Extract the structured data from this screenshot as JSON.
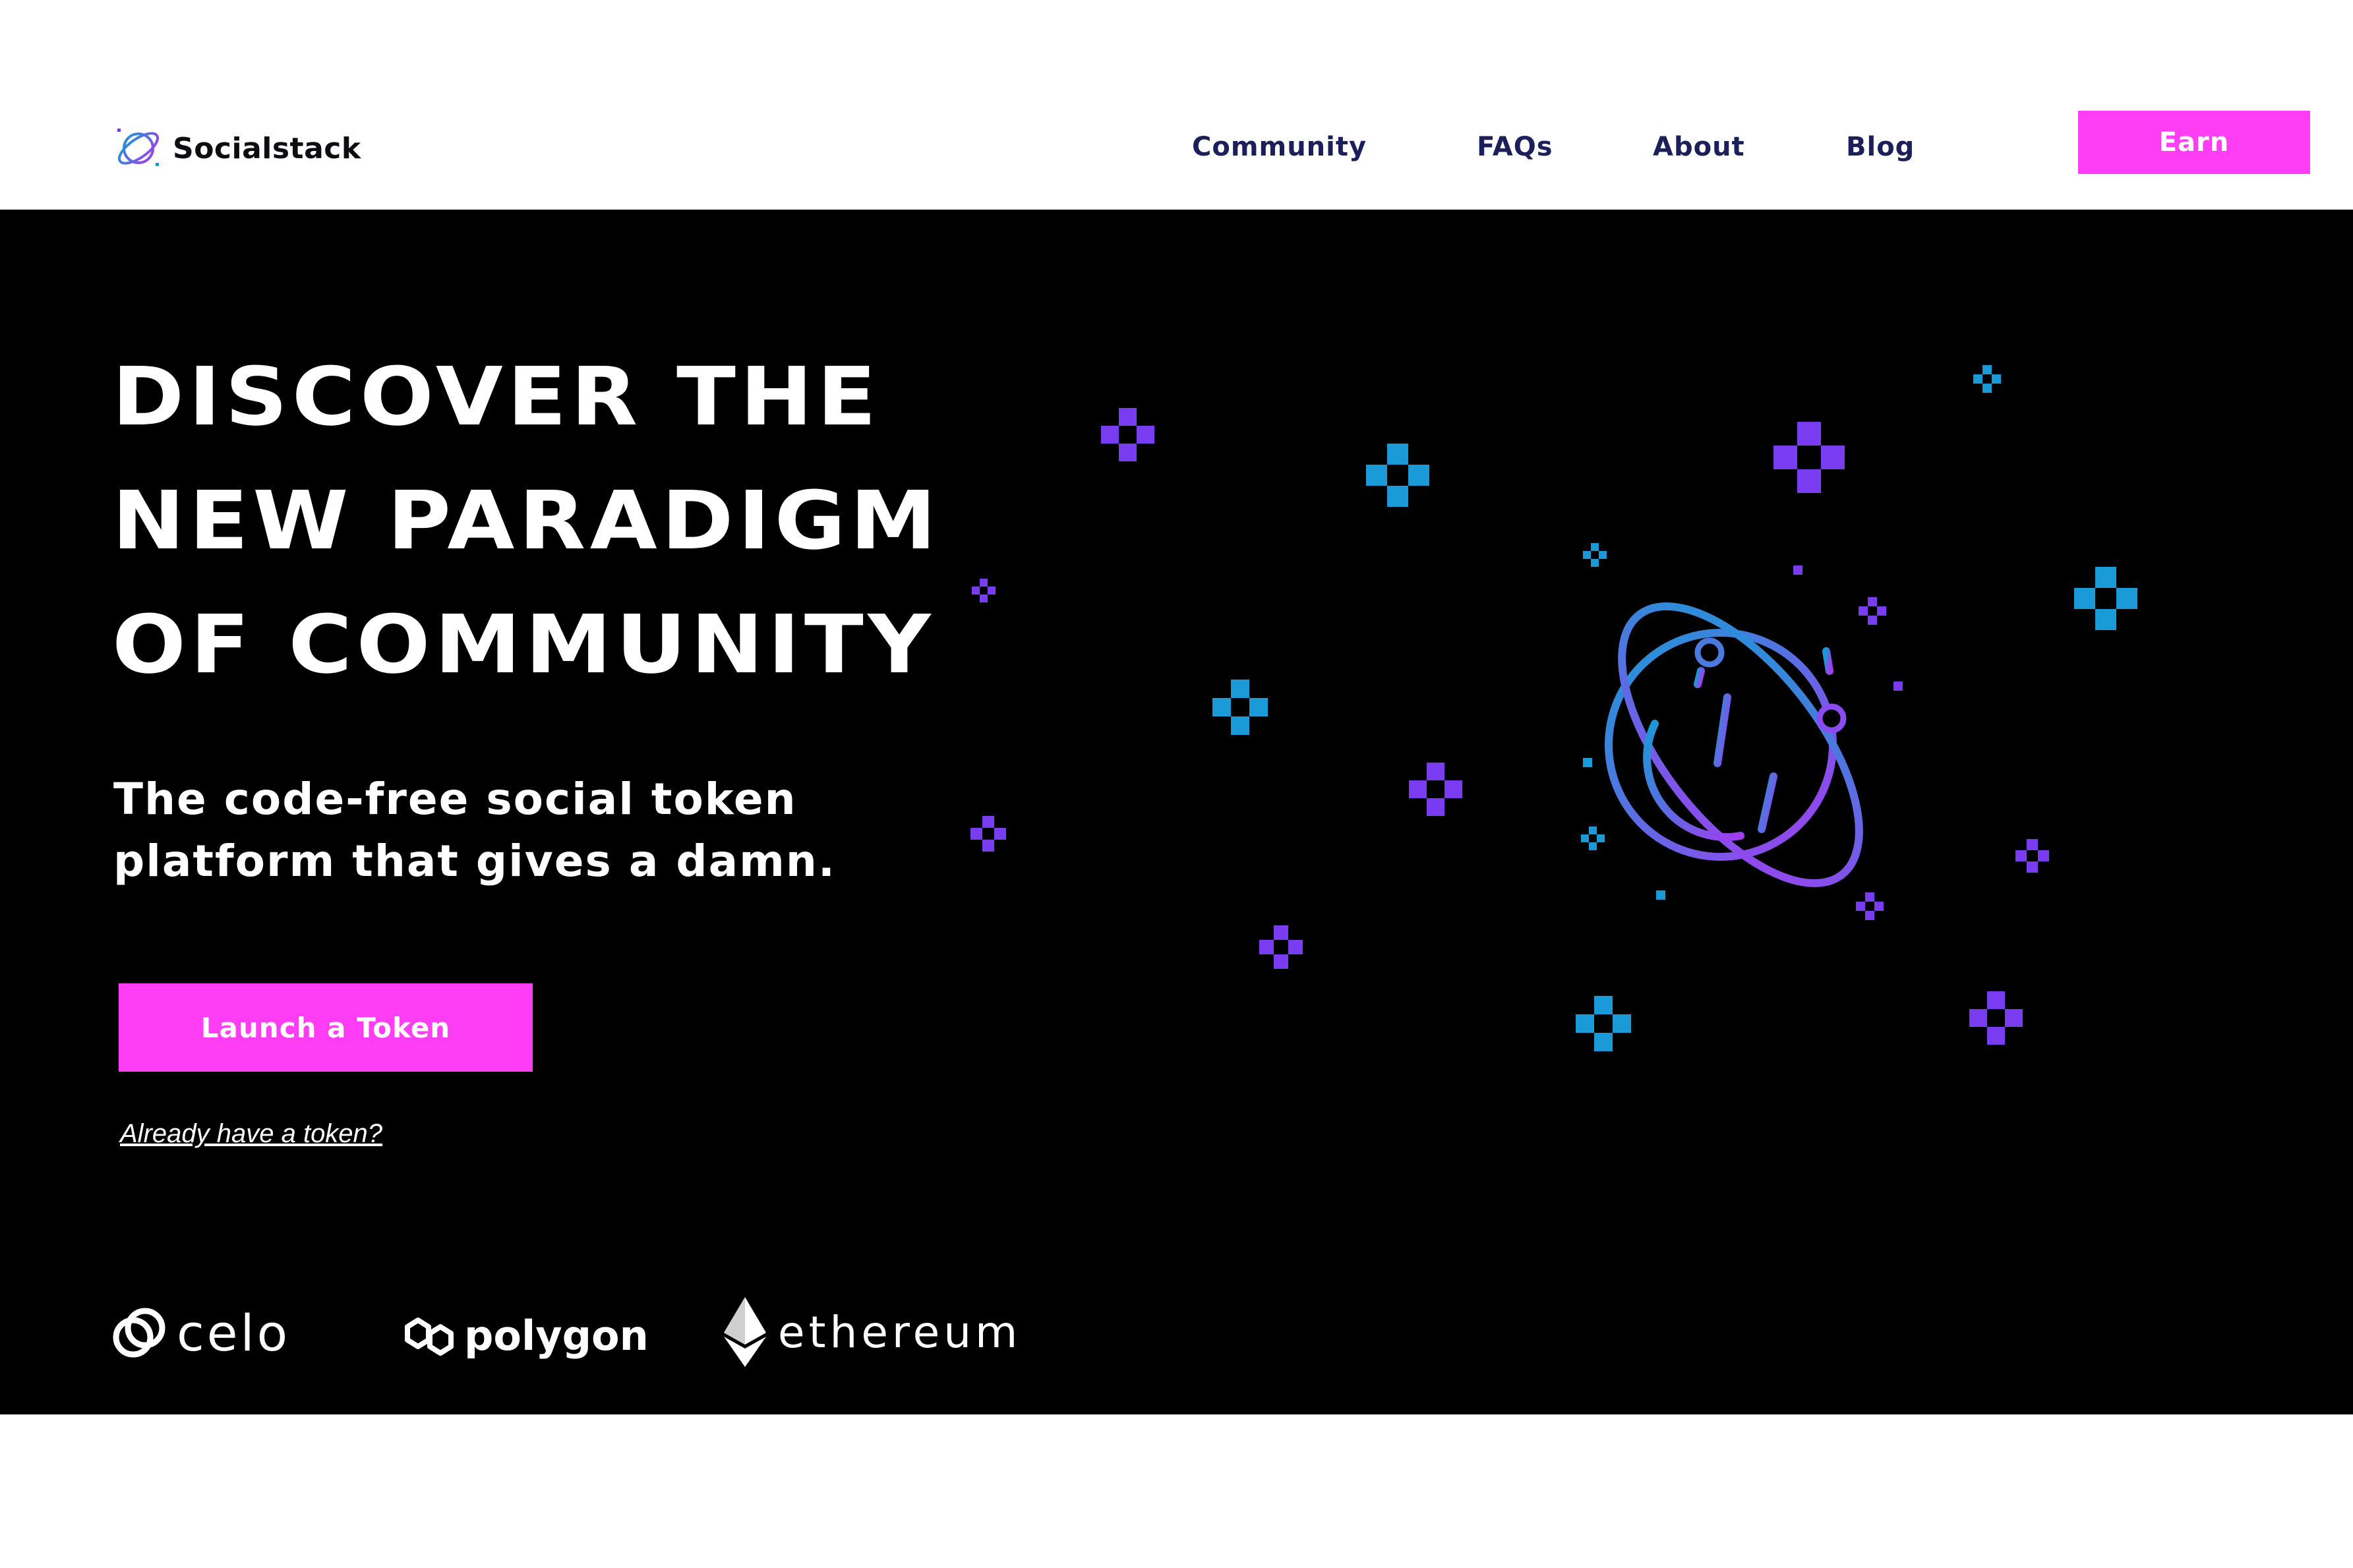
{
  "brand": {
    "name": "Socialstack"
  },
  "nav": {
    "items": [
      "Community",
      "FAQs",
      "About",
      "Blog"
    ],
    "cta_label": "Earn"
  },
  "hero": {
    "headline": [
      "DISCOVER THE",
      "NEW PARADIGM",
      "OF COMMUNITY"
    ],
    "subheadline": [
      "The code-free social token",
      "platform that gives a damn."
    ],
    "cta_label": "Launch a Token",
    "secondary_link": "Already have a token?"
  },
  "partners": [
    "celo",
    "polygon",
    "ethereum"
  ],
  "colors": {
    "accent": "#ff3df5",
    "nav_text": "#1b1f5a",
    "hero_bg": "#000000",
    "pixel_purple": "#7a3cf0",
    "pixel_cyan": "#1a9ad6"
  },
  "icons": {
    "logo": "planet-logo-icon",
    "celo": "celo-logo-icon",
    "polygon": "polygon-logo-icon",
    "ethereum": "ethereum-logo-icon",
    "illustration": "planet-illustration"
  }
}
